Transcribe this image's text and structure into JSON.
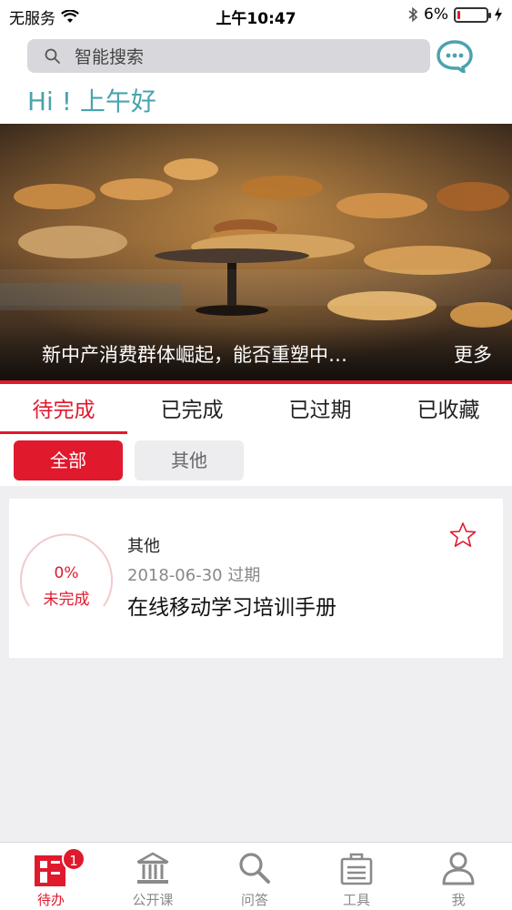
{
  "status_bar": {
    "carrier": "无服务",
    "time": "上午10:47",
    "battery": "6%",
    "battery_level": 0.06
  },
  "search": {
    "placeholder": "智能搜索"
  },
  "greeting": "Hi ! 上午好",
  "banner": {
    "title": "新中产消费群体崛起，能否重塑中…",
    "more": "更多"
  },
  "tabs": [
    {
      "label": "待完成",
      "active": true
    },
    {
      "label": "已完成",
      "active": false
    },
    {
      "label": "已过期",
      "active": false
    },
    {
      "label": "已收藏",
      "active": false
    }
  ],
  "filters": {
    "all": "全部",
    "other": "其他"
  },
  "card": {
    "progress_percent": "0%",
    "progress_value": 0,
    "status": "未完成",
    "category": "其他",
    "date": "2018-06-30 过期",
    "title": "在线移动学习培训手册"
  },
  "bottom_nav": [
    {
      "label": "待办",
      "icon": "todo-icon",
      "badge": "1",
      "active": true
    },
    {
      "label": "公开课",
      "icon": "classroom-icon",
      "active": false
    },
    {
      "label": "问答",
      "icon": "search-icon",
      "active": false
    },
    {
      "label": "工具",
      "icon": "toolbox-icon",
      "active": false
    },
    {
      "label": "我",
      "icon": "profile-icon",
      "active": false
    }
  ],
  "colors": {
    "accent": "#e0192d",
    "teal": "#4aa3ad",
    "nav_inactive": "#8a8a8a"
  }
}
